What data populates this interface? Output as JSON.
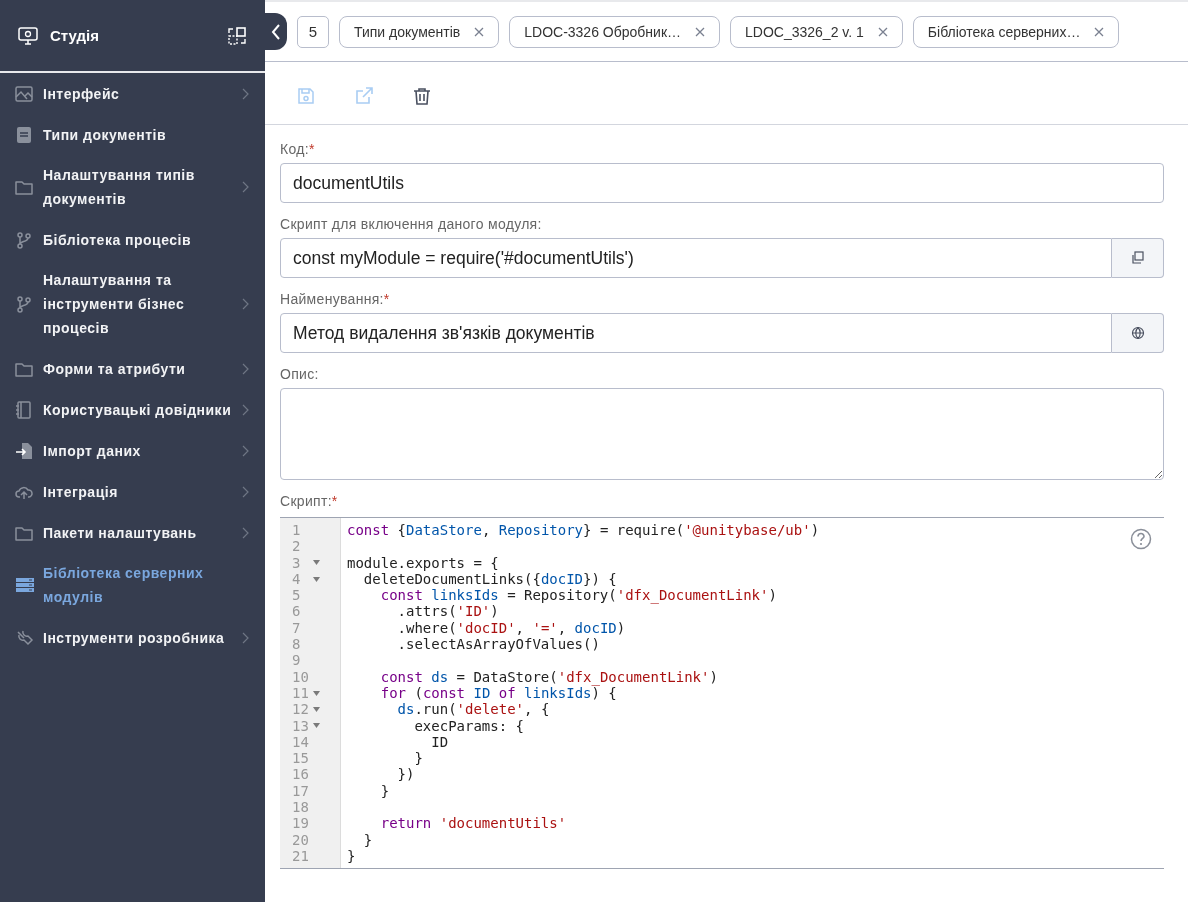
{
  "sidebar": {
    "title": "Студія",
    "items": [
      {
        "label": "Інтерфейс",
        "arrow": true,
        "selected": false
      },
      {
        "label": "Типи документів",
        "arrow": false,
        "selected": false
      },
      {
        "label": "Налаштування типів документів",
        "arrow": true,
        "selected": false
      },
      {
        "label": "Бібліотека процесів",
        "arrow": false,
        "selected": false
      },
      {
        "label": "Налаштування та інструменти бізнес процесів",
        "arrow": true,
        "selected": false
      },
      {
        "label": "Форми та атрибути",
        "arrow": true,
        "selected": false
      },
      {
        "label": "Користувацькі довідники",
        "arrow": true,
        "selected": false
      },
      {
        "label": "Імпорт даних",
        "arrow": true,
        "selected": false
      },
      {
        "label": "Інтеграція",
        "arrow": true,
        "selected": false
      },
      {
        "label": "Пакети налаштувань",
        "arrow": true,
        "selected": false
      },
      {
        "label": "Бібліотека серверних модулів",
        "arrow": false,
        "selected": true
      },
      {
        "label": "Інструменти розробника",
        "arrow": true,
        "selected": false
      }
    ]
  },
  "tabs": {
    "count": "5",
    "items": [
      {
        "label": "Типи документів"
      },
      {
        "label": "LDOC-3326 Обробник…"
      },
      {
        "label": "LDOC_3326_2 v. 1"
      },
      {
        "label": "Бібліотека серверних…"
      }
    ]
  },
  "toolbar": [
    {
      "kind": "save",
      "disabled": true
    },
    {
      "kind": "export",
      "disabled": true
    },
    {
      "kind": "delete",
      "disabled": false
    }
  ],
  "form": [
    {
      "kind": "input",
      "label": "Код:",
      "required_mark": "*",
      "value": "documentUtils"
    },
    {
      "kind": "input_copy",
      "label": "Скрипт для включення даного модуля:",
      "value": "const myModule = require('#documentUtils')"
    },
    {
      "kind": "input_translate",
      "label": "Найменування:",
      "required_mark": "*",
      "value": "Метод видалення зв'язків документів"
    },
    {
      "kind": "textarea",
      "label": "Опис:"
    },
    {
      "kind": "code",
      "label": "Скрипт:",
      "required_mark": "*",
      "lines": [
        {
          "n": "1",
          "tokens": [
            {
              "kind": "keyword",
              "text": "const"
            },
            {
              "kind": "plain",
              "text": " {"
            },
            {
              "kind": "variable",
              "text": "DataStore"
            },
            {
              "kind": "plain",
              "text": ", "
            },
            {
              "kind": "variable",
              "text": "Repository"
            },
            {
              "kind": "plain",
              "text": "} = require("
            },
            {
              "kind": "string",
              "text": "'@unitybase/ub'"
            },
            {
              "kind": "plain",
              "text": ")"
            }
          ]
        },
        {
          "n": "2"
        },
        {
          "n": "3",
          "fold": true,
          "tokens": [
            {
              "kind": "plain",
              "text": "module.exports = {"
            }
          ]
        },
        {
          "n": "4",
          "fold": true,
          "tokens": [
            {
              "kind": "plain",
              "text": "  deleteDocumentLinks({"
            },
            {
              "kind": "variable",
              "text": "docID"
            },
            {
              "kind": "plain",
              "text": "}) {"
            }
          ]
        },
        {
          "n": "5",
          "tokens": [
            {
              "kind": "keyword",
              "text": "    const"
            },
            {
              "kind": "variable",
              "text": " linksIds"
            },
            {
              "kind": "plain",
              "text": " = Repository("
            },
            {
              "kind": "string",
              "text": "'dfx_DocumentLink'"
            },
            {
              "kind": "plain",
              "text": ")"
            }
          ]
        },
        {
          "n": "6",
          "tokens": [
            {
              "kind": "plain",
              "text": "      .attrs("
            },
            {
              "kind": "string",
              "text": "'ID'"
            },
            {
              "kind": "plain",
              "text": ")"
            }
          ]
        },
        {
          "n": "7",
          "tokens": [
            {
              "kind": "plain",
              "text": "      .where("
            },
            {
              "kind": "string",
              "text": "'docID'"
            },
            {
              "kind": "plain",
              "text": ", "
            },
            {
              "kind": "string",
              "text": "'='"
            },
            {
              "kind": "plain",
              "text": ", "
            },
            {
              "kind": "variable",
              "text": "docID"
            },
            {
              "kind": "plain",
              "text": ")"
            }
          ]
        },
        {
          "n": "8",
          "tokens": [
            {
              "kind": "plain",
              "text": "      .selectAsArrayOfValues()"
            }
          ]
        },
        {
          "n": "9"
        },
        {
          "n": "10",
          "tokens": [
            {
              "kind": "keyword",
              "text": "    const"
            },
            {
              "kind": "variable",
              "text": " ds"
            },
            {
              "kind": "plain",
              "text": " = DataStore("
            },
            {
              "kind": "string",
              "text": "'dfx_DocumentLink'"
            },
            {
              "kind": "plain",
              "text": ")"
            }
          ]
        },
        {
          "n": "11",
          "fold": true,
          "tokens": [
            {
              "kind": "keyword",
              "text": "    for"
            },
            {
              "kind": "plain",
              "text": " ("
            },
            {
              "kind": "keyword",
              "text": "const"
            },
            {
              "kind": "variable",
              "text": " ID"
            },
            {
              "kind": "keyword",
              "text": " of"
            },
            {
              "kind": "variable",
              "text": " linksIds"
            },
            {
              "kind": "plain",
              "text": ") {"
            }
          ]
        },
        {
          "n": "12",
          "fold": true,
          "tokens": [
            {
              "kind": "variable",
              "text": "      ds"
            },
            {
              "kind": "plain",
              "text": ".run("
            },
            {
              "kind": "string",
              "text": "'delete'"
            },
            {
              "kind": "plain",
              "text": ", {"
            }
          ]
        },
        {
          "n": "13",
          "fold": true,
          "tokens": [
            {
              "kind": "plain",
              "text": "        execParams: {"
            }
          ]
        },
        {
          "n": "14",
          "tokens": [
            {
              "kind": "plain",
              "text": "          ID"
            }
          ]
        },
        {
          "n": "15",
          "tokens": [
            {
              "kind": "plain",
              "text": "        }"
            }
          ]
        },
        {
          "n": "16",
          "tokens": [
            {
              "kind": "plain",
              "text": "      })"
            }
          ]
        },
        {
          "n": "17",
          "tokens": [
            {
              "kind": "plain",
              "text": "    }"
            }
          ]
        },
        {
          "n": "18"
        },
        {
          "n": "19",
          "tokens": [
            {
              "kind": "keyword",
              "text": "    return"
            },
            {
              "kind": "string",
              "text": " 'documentUtils'"
            }
          ]
        },
        {
          "n": "20",
          "tokens": [
            {
              "kind": "plain",
              "text": "  }"
            }
          ]
        },
        {
          "n": "21",
          "tokens": [
            {
              "kind": "plain",
              "text": "}"
            }
          ]
        }
      ]
    }
  ]
}
